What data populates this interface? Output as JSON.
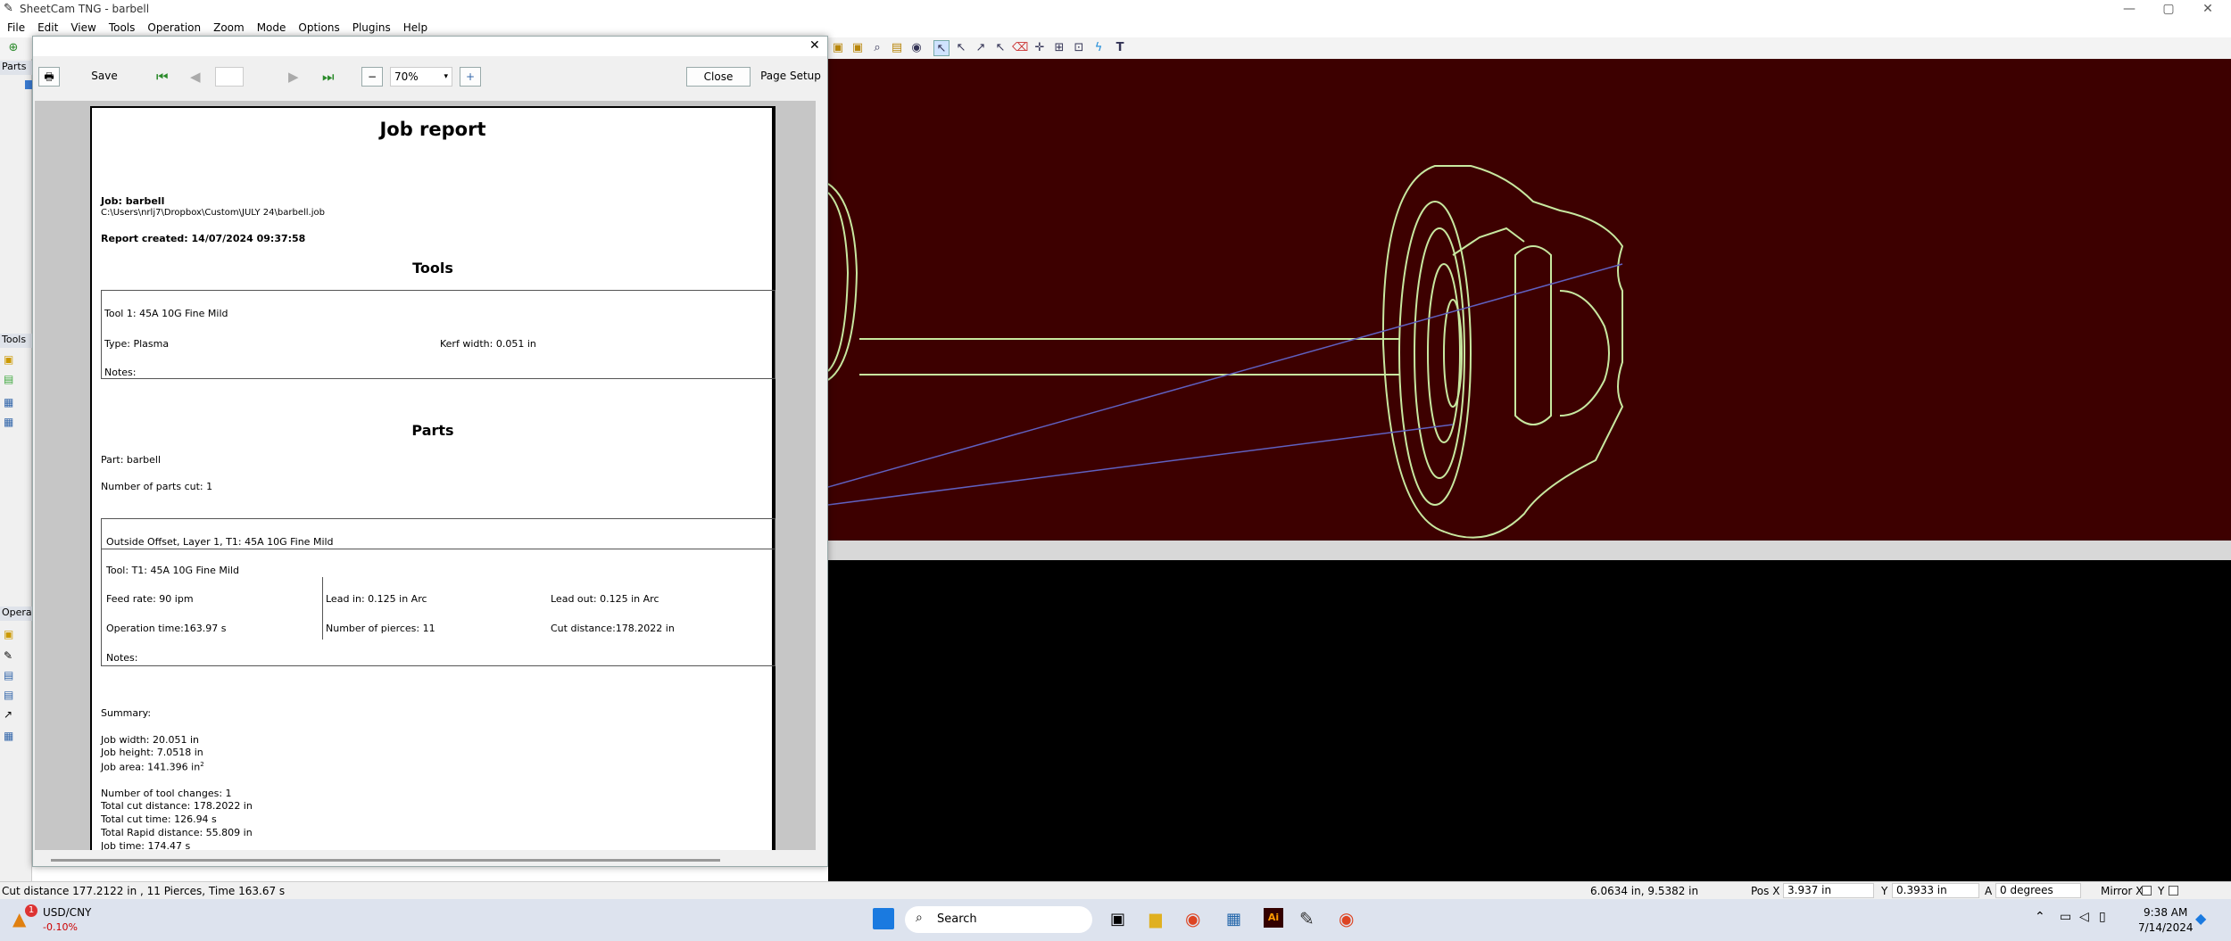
{
  "window": {
    "title": "SheetCam TNG - barbell"
  },
  "menu": [
    "File",
    "Edit",
    "View",
    "Tools",
    "Operation",
    "Zoom",
    "Mode",
    "Options",
    "Plugins",
    "Help"
  ],
  "panels": {
    "parts": "Parts",
    "tools": "Tools",
    "operations": "Operat"
  },
  "preview": {
    "save": "Save",
    "zoom": "70%",
    "close": "Close",
    "page_setup": "Page Setup"
  },
  "report": {
    "title": "Job report",
    "job": "Job: barbell",
    "path": "C:\\Users\\nrlj7\\Dropbox\\Custom\\JULY 24\\barbell.job",
    "created": "Report created: 14/07/2024 09:37:58",
    "tools_heading": "Tools",
    "tool_name": "Tool 1: 45A 10G Fine Mild",
    "tool_type": "Type: Plasma",
    "kerf": "Kerf width: 0.051 in",
    "tool_notes": "Notes:",
    "parts_heading": "Parts",
    "part": "Part: barbell",
    "parts_cut": "Number of parts cut: 1",
    "op_name": "Outside Offset, Layer 1, T1: 45A 10G Fine Mild",
    "op_tool": "Tool: T1: 45A 10G Fine Mild",
    "feed": "Feed rate: 90 ipm",
    "lead_in": "Lead in: 0.125 in Arc",
    "lead_out": "Lead out: 0.125 in Arc",
    "op_time": "Operation time:163.97 s",
    "pierces": "Number of pierces: 11",
    "cut_dist": "Cut distance:178.2022 in",
    "op_notes": "Notes:",
    "summary": "Summary:",
    "job_width": "Job width: 20.051 in",
    "job_height": "Job height: 7.0518 in",
    "job_area": "Job area: 141.396 in",
    "area_sup": "2",
    "tool_changes": "Number of tool changes: 1",
    "total_cut": "Total cut distance: 178.2022 in",
    "total_time": "Total cut time: 126.94 s",
    "rapid": "Total Rapid distance: 55.809 in",
    "job_time": "Job time: 174.47 s"
  },
  "status": {
    "left": "Cut distance 177.2122 in , 11 Pierces, Time 163.67 s",
    "coords": "6.0634 in, 9.5382 in",
    "posx_label": "Pos X",
    "posx": "3.937 in",
    "y_label": "Y",
    "y": "0.3933 in",
    "a_label": "A",
    "a": "0 degrees",
    "mirror_x": "Mirror X",
    "mirror_y": "Y"
  },
  "taskbar": {
    "ticker": "USD/CNY",
    "change": "-0.10%",
    "search": "Search",
    "time": "9:38 AM",
    "date": "7/14/2024",
    "badge": "1"
  }
}
